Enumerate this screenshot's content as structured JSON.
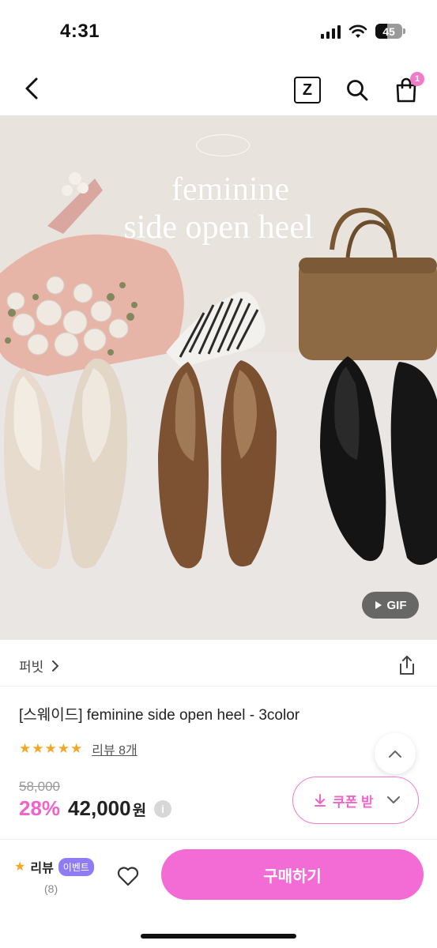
{
  "status_bar": {
    "time": "4:31",
    "battery": "45",
    "battery_level": 0.45
  },
  "nav": {
    "z_label": "Z",
    "cart_count": "1"
  },
  "hero": {
    "title_line1": "feminine",
    "title_line2": "side open heel",
    "gif_label": "GIF"
  },
  "shop": {
    "name": "퍼빗"
  },
  "product": {
    "title": "[스웨이드] feminine side open heel - 3color",
    "rating_stars": 5,
    "review_link": "리뷰 8개",
    "original_price": "58,000",
    "discount": "28%",
    "price": "42,000",
    "price_unit": "원",
    "coupon_label": "쿠폰 받"
  },
  "bottom_bar": {
    "review_label": "리뷰",
    "event_badge": "이벤트",
    "review_count": "(8)",
    "buy_label": "구매하기"
  },
  "colors": {
    "accent_pink": "#f063c9",
    "buy_button": "#f36cd5",
    "star": "#f5a623",
    "event_badge": "#8e7bf5"
  }
}
